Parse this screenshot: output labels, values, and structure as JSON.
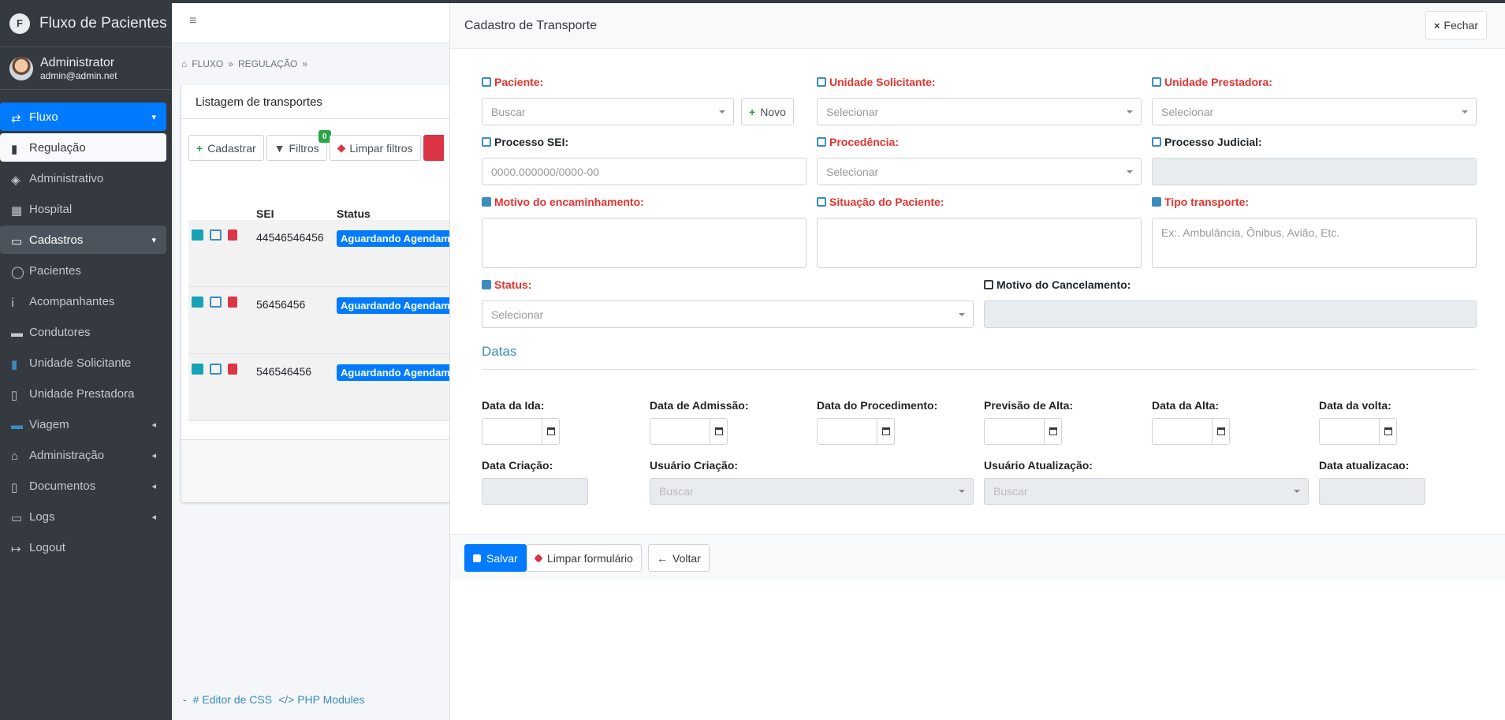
{
  "app": {
    "brand_letter": "F",
    "brand_name": "Fluxo de Pacientes"
  },
  "user": {
    "name": "Administrator",
    "email": "admin@admin.net"
  },
  "sidebar": {
    "items": [
      {
        "label": "Fluxo",
        "icon": "exchange-icon",
        "state": "active"
      },
      {
        "label": "Regulação",
        "icon": "truck-icon",
        "state": "sub-active"
      },
      {
        "label": "Administrativo",
        "icon": "layers-icon",
        "state": ""
      },
      {
        "label": "Hospital",
        "icon": "hospital-icon",
        "state": ""
      },
      {
        "label": "Cadastros",
        "icon": "id-card-icon",
        "state": "open"
      },
      {
        "label": "Pacientes",
        "icon": "user-icon",
        "state": ""
      },
      {
        "label": "Acompanhantes",
        "icon": "person-icon",
        "state": ""
      },
      {
        "label": "Condutores",
        "icon": "car-icon",
        "state": ""
      },
      {
        "label": "Unidade Solicitante",
        "icon": "building-icon",
        "state": "blue"
      },
      {
        "label": "Unidade Prestadora",
        "icon": "building-outline-icon",
        "state": ""
      },
      {
        "label": "Viagem",
        "icon": "car-blue-icon",
        "state": "blue"
      },
      {
        "label": "Administração",
        "icon": "home-icon",
        "state": ""
      },
      {
        "label": "Documentos",
        "icon": "file-icon",
        "state": ""
      },
      {
        "label": "Logs",
        "icon": "monitor-icon",
        "state": ""
      },
      {
        "label": "Logout",
        "icon": "logout-icon",
        "state": ""
      }
    ]
  },
  "header": {
    "menu_icon": "≡"
  },
  "breadcrumb": {
    "items": [
      "FLUXO",
      "REGULAÇÃO"
    ]
  },
  "listing": {
    "title": "Listagem de transportes",
    "btn_cadastrar": "Cadastrar",
    "btn_filtros": "Filtros",
    "filtros_count": "0",
    "btn_limpar": "Limpar filtros",
    "columns": {
      "sei": "SEI",
      "status": "Status"
    },
    "rows": [
      {
        "sei": "44546546456",
        "status": "Aguardando Agendamento"
      },
      {
        "sei": "56456456",
        "status": "Aguardando Agendamento"
      },
      {
        "sei": "546546456",
        "status": "Aguardando Agendamento"
      }
    ]
  },
  "footer": {
    "dash": "-",
    "link1": "Editor de CSS",
    "link2": "PHP Modules"
  },
  "modal": {
    "title": "Cadastro de Transporte",
    "close_label": "Fechar",
    "fields": {
      "paciente": {
        "label": "Paciente:",
        "placeholder": "Buscar"
      },
      "novo": "Novo",
      "unidade_solicitante": {
        "label": "Unidade Solicitante:",
        "placeholder": "Selecionar"
      },
      "unidade_prestadora": {
        "label": "Unidade Prestadora:",
        "placeholder": "Selecionar"
      },
      "processo_sei": {
        "label": "Processo SEI:",
        "placeholder": "0000.000000/0000-00"
      },
      "procedencia": {
        "label": "Procedência:",
        "placeholder": "Selecionar"
      },
      "processo_judicial": {
        "label": "Processo Judicial:"
      },
      "motivo_encaminhamento": {
        "label": "Motivo do encaminhamento:"
      },
      "situacao_paciente": {
        "label": "Situação do Paciente:"
      },
      "tipo_transporte": {
        "label": "Tipo transporte:",
        "placeholder": "Ex:. Ambulância, Ônibus, Avião, Etc."
      },
      "status": {
        "label": "Status:",
        "placeholder": "Selecionar"
      },
      "motivo_cancelamento": {
        "label": "Motivo do Cancelamento:"
      }
    },
    "datas_title": "Datas",
    "dates": {
      "ida": "Data da Ida:",
      "admissao": "Data de Admissão:",
      "procedimento": "Data do Procedimento:",
      "previsao_alta": "Previsão de Alta:",
      "alta": "Data da Alta:",
      "volta": "Data da volta:"
    },
    "meta": {
      "data_criacao": "Data Criação:",
      "usuario_criacao": {
        "label": "Usuário Criação:",
        "placeholder": "Buscar"
      },
      "usuario_atualizacao": {
        "label": "Usuário Atualização:",
        "placeholder": "Buscar"
      },
      "data_atualizacao": "Data atualizacao:"
    },
    "buttons": {
      "salvar": "Salvar",
      "limpar": "Limpar formulário",
      "voltar": "Voltar"
    }
  },
  "colors": {
    "primary": "#007bff",
    "required": "#e3342f",
    "sidebar": "#343a40",
    "accent": "#3c8dbc"
  }
}
